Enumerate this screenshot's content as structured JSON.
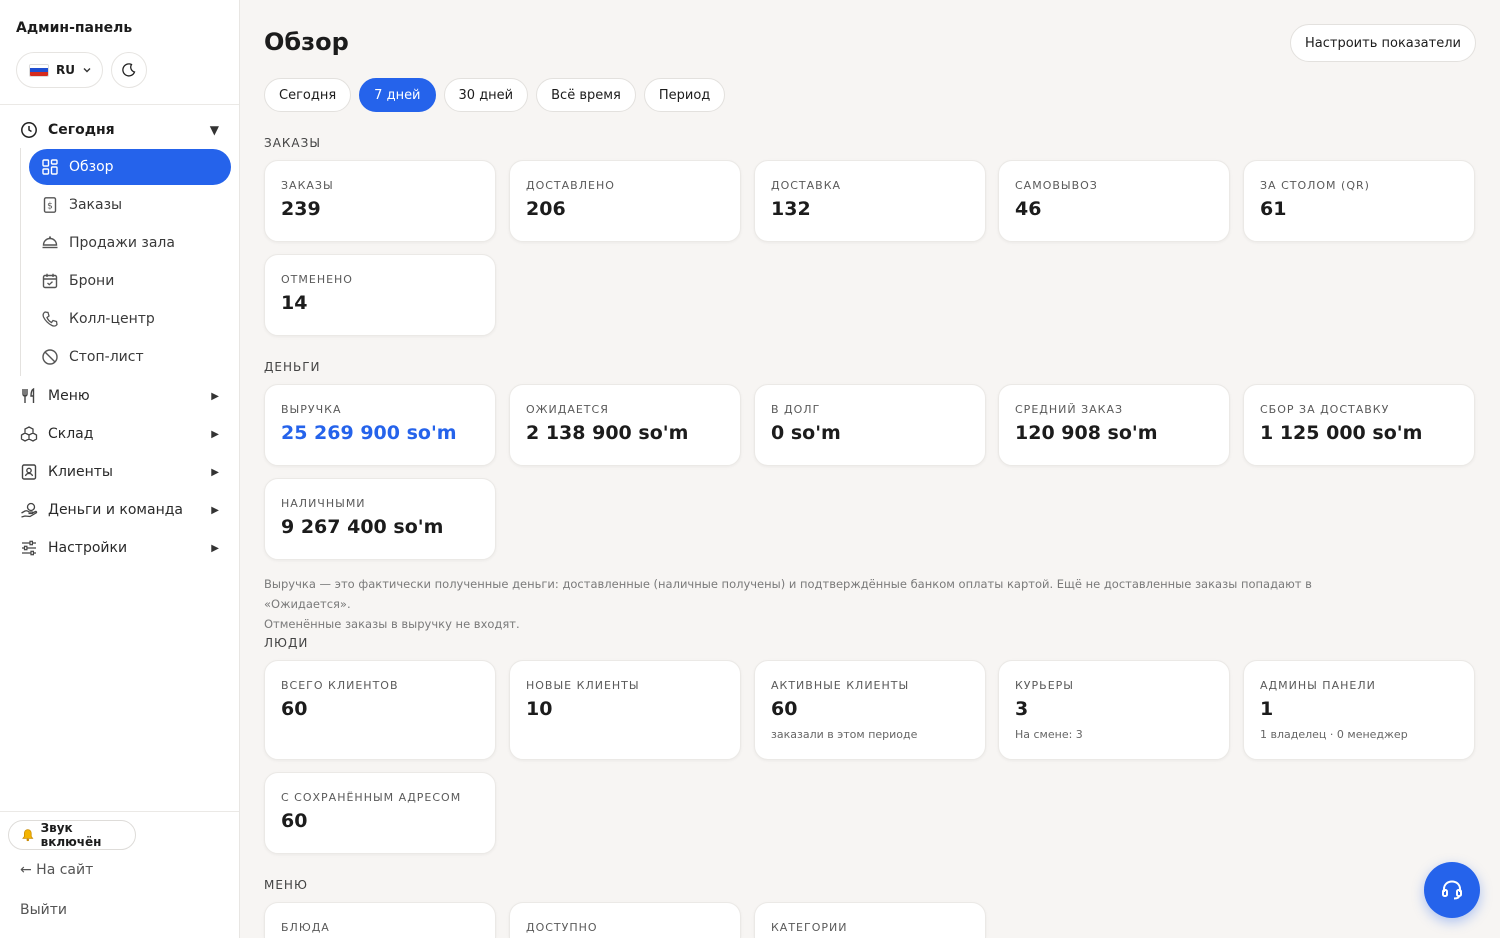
{
  "sidebar": {
    "brand": "Админ-панель",
    "lang": "RU",
    "groups": {
      "today": {
        "label": "Сегодня",
        "arrow": "▼"
      },
      "menu": {
        "label": "Меню",
        "arrow": "▶"
      },
      "warehouse": {
        "label": "Склад",
        "arrow": "▶"
      },
      "clients": {
        "label": "Клиенты",
        "arrow": "▶"
      },
      "money": {
        "label": "Деньги и команда",
        "arrow": "▶"
      },
      "settings": {
        "label": "Настройки",
        "arrow": "▶"
      }
    },
    "items": {
      "overview": "Обзор",
      "orders": "Заказы",
      "hall_sales": "Продажи зала",
      "bookings": "Брони",
      "call_center": "Колл-центр",
      "stop_list": "Стоп-лист"
    },
    "sound": "Звук включён",
    "to_site": "← На сайт",
    "logout": "Выйти"
  },
  "header": {
    "title": "Обзор",
    "config_button": "Настроить показатели"
  },
  "tabs": [
    "Сегодня",
    "7 дней",
    "30 дней",
    "Всё время",
    "Период"
  ],
  "active_tab": "7 дней",
  "sections": {
    "orders": {
      "label": "ЗАКАЗЫ",
      "cards": [
        {
          "label": "ЗАКАЗЫ",
          "value": "239"
        },
        {
          "label": "ДОСТАВЛЕНО",
          "value": "206"
        },
        {
          "label": "ДОСТАВКА",
          "value": "132"
        },
        {
          "label": "САМОВЫВОЗ",
          "value": "46"
        },
        {
          "label": "ЗА СТОЛОМ (QR)",
          "value": "61"
        },
        {
          "label": "ОТМЕНЕНО",
          "value": "14"
        }
      ]
    },
    "money": {
      "label": "ДЕНЬГИ",
      "cards": [
        {
          "label": "ВЫРУЧКА",
          "value": "25 269 900 so'm"
        },
        {
          "label": "ОЖИДАЕТСЯ",
          "value": "2 138 900 so'm"
        },
        {
          "label": "В ДОЛГ",
          "value": "0 so'm"
        },
        {
          "label": "СРЕДНИЙ ЗАКАЗ",
          "value": "120 908 so'm"
        },
        {
          "label": "СБОР ЗА ДОСТАВКУ",
          "value": "1 125 000 so'm"
        },
        {
          "label": "НАЛИЧНЫМИ",
          "value": "9 267 400 so'm"
        }
      ],
      "note_line1": "Выручка — это фактически полученные деньги: доставленные (наличные получены) и подтверждённые банком оплаты картой. Ещё не доставленные заказы попадают в «Ожидается».",
      "note_line2": "Отменённые заказы в выручку не входят."
    },
    "people": {
      "label": "ЛЮДИ",
      "cards": [
        {
          "label": "ВСЕГО КЛИЕНТОВ",
          "value": "60"
        },
        {
          "label": "НОВЫЕ КЛИЕНТЫ",
          "value": "10"
        },
        {
          "label": "АКТИВНЫЕ КЛИЕНТЫ",
          "value": "60",
          "sub": "заказали в этом периоде"
        },
        {
          "label": "КУРЬЕРЫ",
          "value": "3",
          "sub": "На смене: 3"
        },
        {
          "label": "АДМИНЫ ПАНЕЛИ",
          "value": "1",
          "sub": "1 владелец · 0 менеджер"
        },
        {
          "label": "С СОХРАНЁННЫМ АДРЕСОМ",
          "value": "60"
        }
      ]
    },
    "menu": {
      "label": "МЕНЮ",
      "cards": [
        {
          "label": "БЛЮДА"
        },
        {
          "label": "ДОСТУПНО"
        },
        {
          "label": "КАТЕГОРИИ"
        }
      ]
    }
  },
  "colors": {
    "accent": "#2563eb",
    "background": "#f7f5f3",
    "card": "#ffffff"
  },
  "icons": {
    "overview": "grid-icon",
    "orders": "receipt-icon",
    "hall_sales": "dish-icon",
    "bookings": "calendar-icon",
    "call_center": "phone-icon",
    "stop_list": "ban-icon",
    "today": "clock-icon",
    "menu": "fork-knife-icon",
    "warehouse": "boxes-icon",
    "clients": "id-card-icon",
    "money": "money-icon",
    "settings": "sliders-icon",
    "support": "headset-icon"
  }
}
